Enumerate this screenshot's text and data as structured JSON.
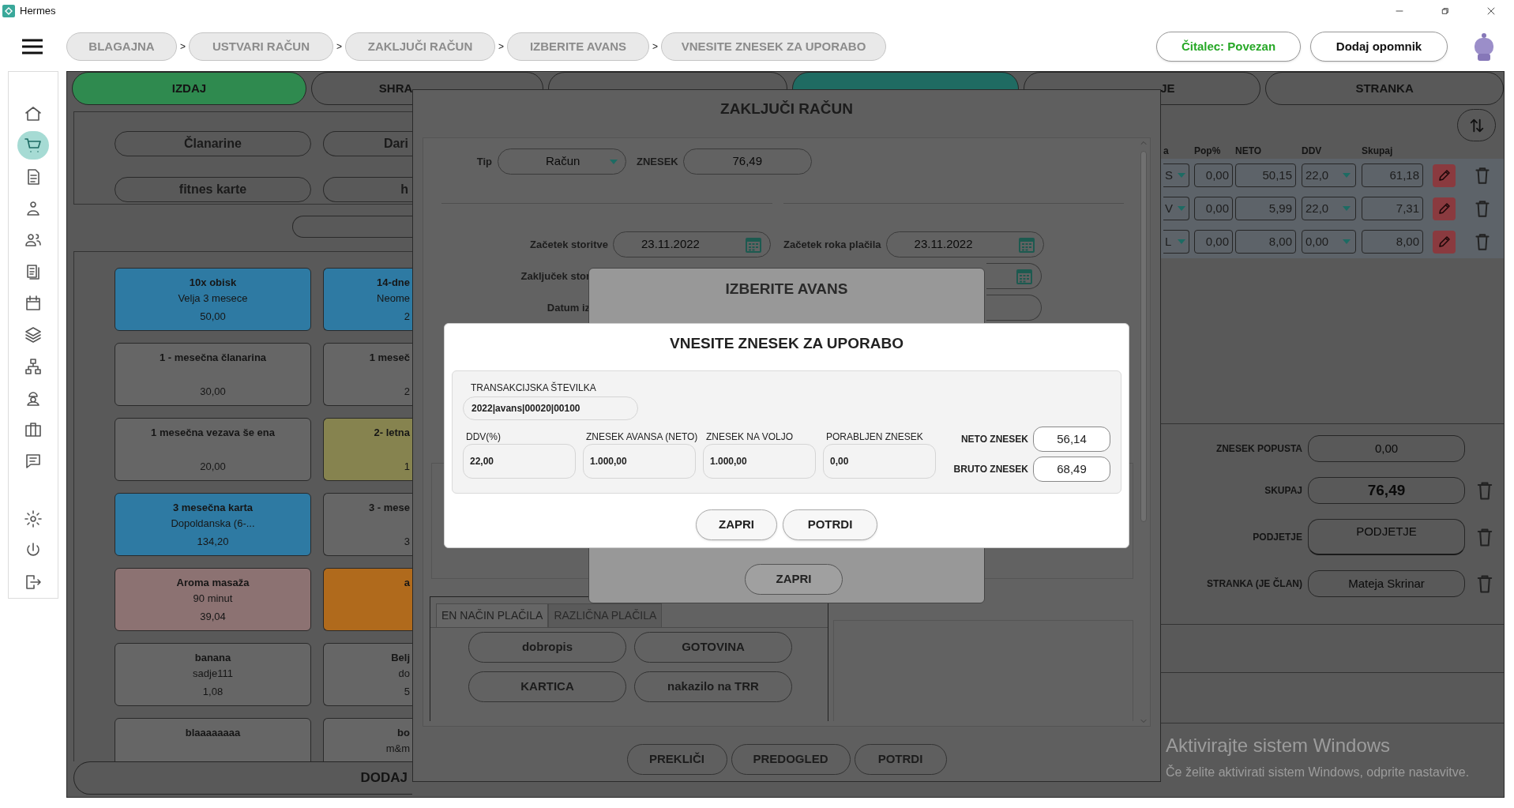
{
  "window": {
    "title": "Hermes"
  },
  "toolbar": {
    "breadcrumbs": [
      "BLAGAJNA",
      "USTVARI RAČUN",
      "ZAKLJUČI RAČUN",
      "IZBERITE AVANS",
      "VNESITE ZNESEK ZA UPORABO"
    ],
    "separators": [
      ">",
      ">",
      ">",
      ">"
    ],
    "reader_status": "Čitalec: Povezan",
    "reminder_button": "Dodaj opomnik"
  },
  "sidebar": {
    "items": [
      {
        "selected": false
      },
      {
        "selected": true
      },
      {
        "selected": false
      },
      {
        "selected": false
      },
      {
        "selected": false
      },
      {
        "selected": false
      },
      {
        "selected": false
      },
      {
        "selected": false
      },
      {
        "selected": false
      },
      {
        "selected": false
      },
      {
        "selected": false
      },
      {
        "selected": false
      }
    ],
    "bottom_items": [
      {
        "selected": false
      },
      {
        "selected": false
      },
      {
        "selected": false
      }
    ]
  },
  "sale_panel": {
    "tabs": [
      {
        "label": "IZDAJ",
        "selected": true
      },
      {
        "label": "SHRA",
        "selected": false
      },
      {
        "selected": false
      }
    ],
    "categories": [
      "Članarine",
      "Dari",
      "fitnes karte",
      "h"
    ],
    "products": [
      {
        "name": "10x obisk",
        "detail": "Velja 3 mesece",
        "price": "50,00",
        "color": "#2e7aa3"
      },
      {
        "name": "14-dne",
        "detail": "Neome",
        "price": "2",
        "color": "#2e7aa3"
      },
      {
        "name": "1 - mesečna članarina",
        "price": "30,00",
        "color": "#666666"
      },
      {
        "name": "1 meseč",
        "price": "2",
        "color": "#666666"
      },
      {
        "name": "1 mesečna vezava še ena",
        "price": "20,00",
        "color": "#666666"
      },
      {
        "name": "2- letna",
        "price": "1",
        "color": "#86834f"
      },
      {
        "name": "3 mesečna karta",
        "detail": "Dopoldanska (6-...",
        "price": "134,20",
        "color": "#2e7aa3"
      },
      {
        "name": "3 - mese",
        "price": "3",
        "color": "#666666"
      },
      {
        "name": "Aroma masaža",
        "detail": "90 minut",
        "price": "39,04",
        "color": "#8c7272"
      },
      {
        "name": "a",
        "color": "#b06a1c"
      },
      {
        "name": "banana",
        "detail": "sadje111",
        "price": "1,08",
        "color": "#666666"
      },
      {
        "name": "Belj",
        "detail": "do",
        "price": "5",
        "color": "#666666"
      },
      {
        "name": "blaaaaaaaa",
        "color": "#666666"
      },
      {
        "name": "bo",
        "detail": "m&m",
        "color": "#666666"
      }
    ],
    "add_button": "DODAJ"
  },
  "bill_panel": {
    "tabs": [
      {
        "selected": true
      },
      {
        "label": "JE",
        "selected": false
      },
      {
        "label": "STRANKA",
        "selected": false
      }
    ],
    "columns": [
      "a",
      "Pop%",
      "NETO",
      "DDV",
      "Skupaj"
    ],
    "rows": [
      {
        "item": "S",
        "discount": "0,00",
        "net": "50,15",
        "vat": "22,0",
        "total": "61,18"
      },
      {
        "item": "V",
        "discount": "0,00",
        "net": "5,99",
        "vat": "22,0",
        "total": "7,31"
      },
      {
        "item": "L",
        "discount": "0,00",
        "net": "8,00",
        "vat": "0,00",
        "total": "8,00"
      }
    ],
    "summary": [
      {
        "label": "ZNESEK POPUSTA",
        "value": "0,00",
        "kind": "field",
        "removable": false
      },
      {
        "label": "SKUPAJ",
        "value": "76,49",
        "kind": "total",
        "removable": true
      },
      {
        "label": "PODJETJE",
        "value": "PODJETJE",
        "kind": "select",
        "removable": true
      },
      {
        "label": "STRANKA (JE ČLAN)",
        "value": "Mateja Skrinar",
        "kind": "field",
        "removable": true
      }
    ]
  },
  "invoice_dialog": {
    "title": "ZAKLJUČI RAČUN",
    "type_label": "Tip",
    "type_value": "Račun",
    "amount_label": "ZNESEK",
    "amount_value": "76,49",
    "dates": [
      {
        "label": "Začetek storitve",
        "value": "23.11.2022"
      },
      {
        "label": "Začetek roka plačila",
        "value": "23.11.2022"
      }
    ],
    "partial_labels": [
      "Zaključek stor",
      "Datum iz"
    ],
    "payment_tabs": [
      {
        "label": "EN NAČIN PLAČILA",
        "selected": true
      },
      {
        "label": "RAZLIČNA PLAČILA",
        "selected": false
      }
    ],
    "payment_methods": [
      "dobropis",
      "GOTOVINA",
      "KARTICA",
      "nakazilo na TRR"
    ],
    "buttons": [
      "PREKLIČI",
      "PREDOGLED",
      "POTRDI"
    ]
  },
  "advance_dialog": {
    "title": "IZBERITE AVANS",
    "close_button": "ZAPRI"
  },
  "amount_dialog": {
    "title": "VNESITE ZNESEK ZA UPORABO",
    "transaction_label": "TRANSAKCIJSKA ŠTEVILKA",
    "transaction_value": "2022|avans|00020|00100",
    "fields": [
      {
        "label": "DDV(%)",
        "value": "22,00"
      },
      {
        "label": "ZNESEK AVANSA (NETO)",
        "value": "1.000,00"
      },
      {
        "label": "ZNESEK NA VOLJO",
        "value": "1.000,00"
      },
      {
        "label": "PORABLJEN ZNESEK",
        "value": "0,00"
      }
    ],
    "net_label": "NETO ZNESEK",
    "net_value": "56,14",
    "gross_label": "BRUTO ZNESEK",
    "gross_value": "68,49",
    "buttons": [
      "ZAPRI",
      "POTRDI"
    ]
  },
  "os_notice": {
    "title": "Aktivirajte sistem Windows",
    "text": "Če želite aktivirati sistem Windows, odprite nastavitve."
  }
}
